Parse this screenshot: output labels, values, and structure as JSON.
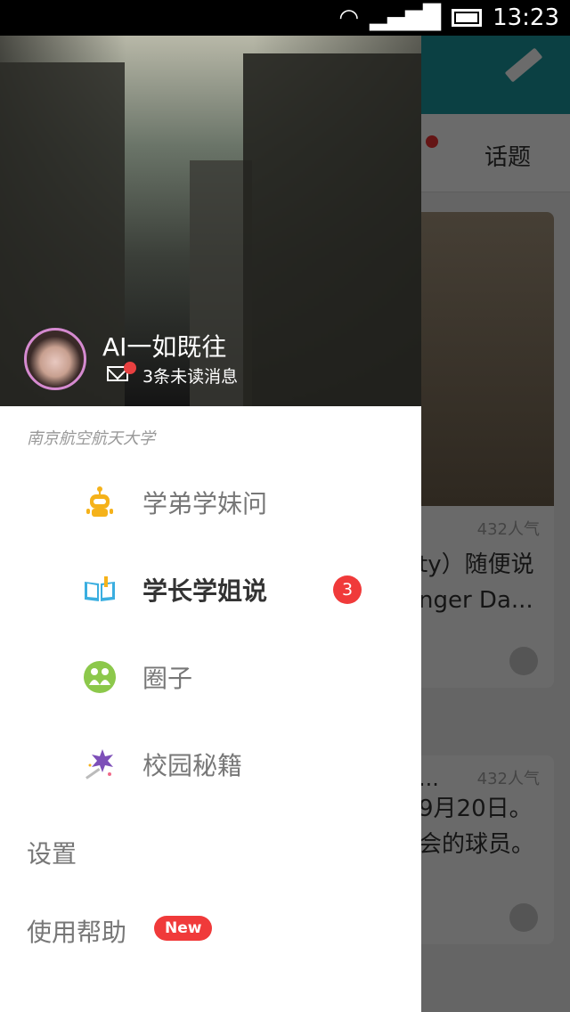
{
  "status_bar": {
    "time": "13:23"
  },
  "background": {
    "tab_label": "话题",
    "card1": {
      "popularity": "432人气",
      "text_line1": "ty）随便说",
      "text_line2": "nger Da..."
    },
    "card2": {
      "popularity": "432人气",
      "title": "...",
      "text_line1": "9月20日。",
      "text_line2": "会的球员。"
    }
  },
  "drawer": {
    "user": {
      "name": "AI一如既往",
      "unread": "3条未读消息"
    },
    "school": "南京航空航天大学",
    "items": [
      {
        "label": "学弟学妹问",
        "icon": "robot-icon",
        "color": "#f5b21a"
      },
      {
        "label": "学长学姐说",
        "icon": "book-icon",
        "color": "#3aaee0",
        "badge": "3",
        "active": true
      },
      {
        "label": "圈子",
        "icon": "people-circle-icon",
        "color": "#8cc84b"
      },
      {
        "label": "校园秘籍",
        "icon": "magic-wand-icon",
        "color": "#7d4fb8"
      }
    ],
    "settings": "设置",
    "help": "使用帮助",
    "help_badge": "New"
  }
}
